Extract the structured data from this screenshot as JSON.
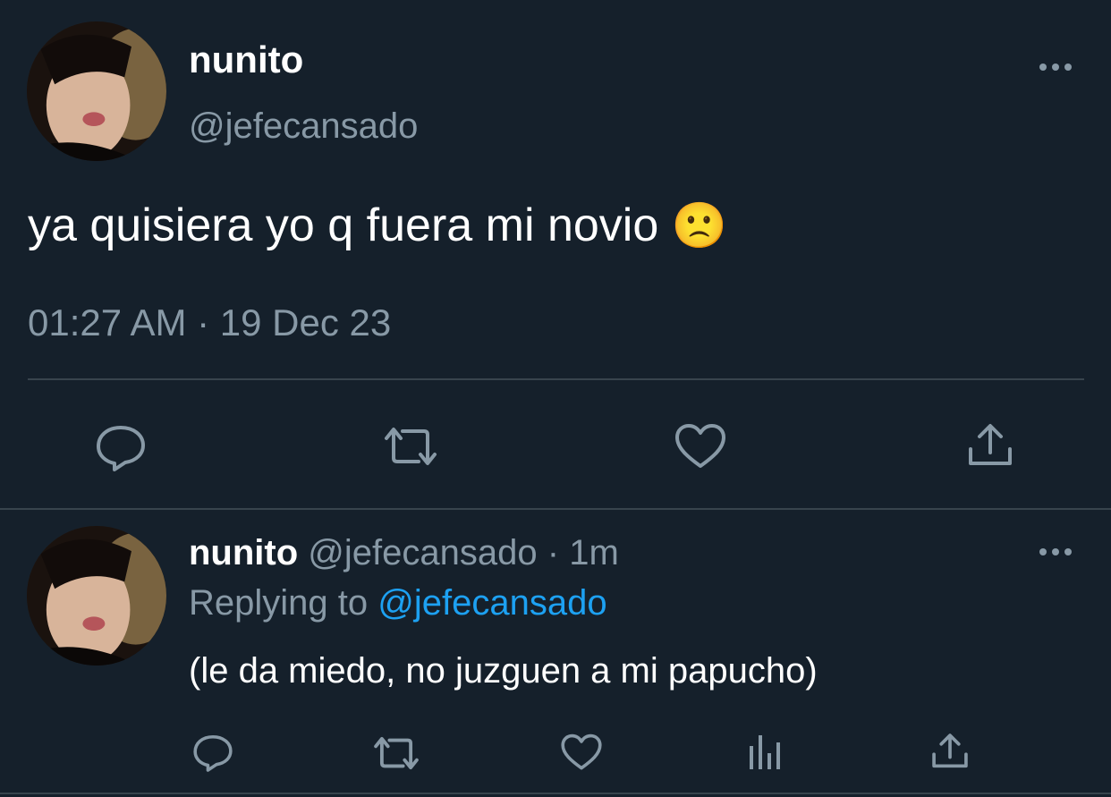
{
  "main_tweet": {
    "display_name": "nunito",
    "handle": "@jefecansado",
    "text": "ya quisiera yo q fuera mi novio",
    "emoji": "🙁",
    "timestamp": "01:27 AM · 19 Dec 23"
  },
  "reply": {
    "display_name": "nunito",
    "handle": "@jefecansado",
    "time_sep": "·",
    "time": "1m",
    "replying_prefix": "Replying to",
    "replying_handle": "@jefecansado",
    "text": "(le da miedo, no juzguen a mi papucho)"
  },
  "icons": {
    "reply": "reply-icon",
    "retweet": "retweet-icon",
    "like": "heart-icon",
    "share": "share-icon",
    "analytics": "analytics-icon",
    "more": "more-icon"
  },
  "colors": {
    "background": "#15202b",
    "muted": "#8899a6",
    "link": "#1da1f2",
    "divider": "#38444d"
  }
}
